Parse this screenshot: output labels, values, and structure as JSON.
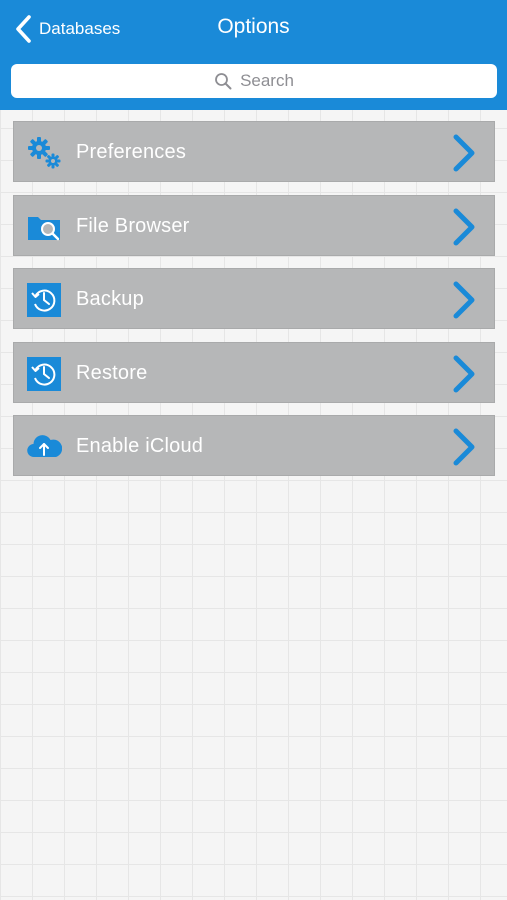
{
  "navbar": {
    "back_label": "Databases",
    "title": "Options"
  },
  "search": {
    "placeholder": "Search"
  },
  "menu": {
    "items": [
      {
        "label": "Preferences",
        "icon": "gears-icon"
      },
      {
        "label": "File Browser",
        "icon": "folder-search-icon"
      },
      {
        "label": "Backup",
        "icon": "clock-history-icon"
      },
      {
        "label": "Restore",
        "icon": "clock-history-icon"
      },
      {
        "label": "Enable iCloud",
        "icon": "cloud-upload-icon"
      }
    ]
  },
  "colors": {
    "navbar_bg": "#1a8ad8",
    "accent": "#1a8ad8",
    "item_bg": "#b6b7b8",
    "page_bg": "#f5f5f5"
  }
}
